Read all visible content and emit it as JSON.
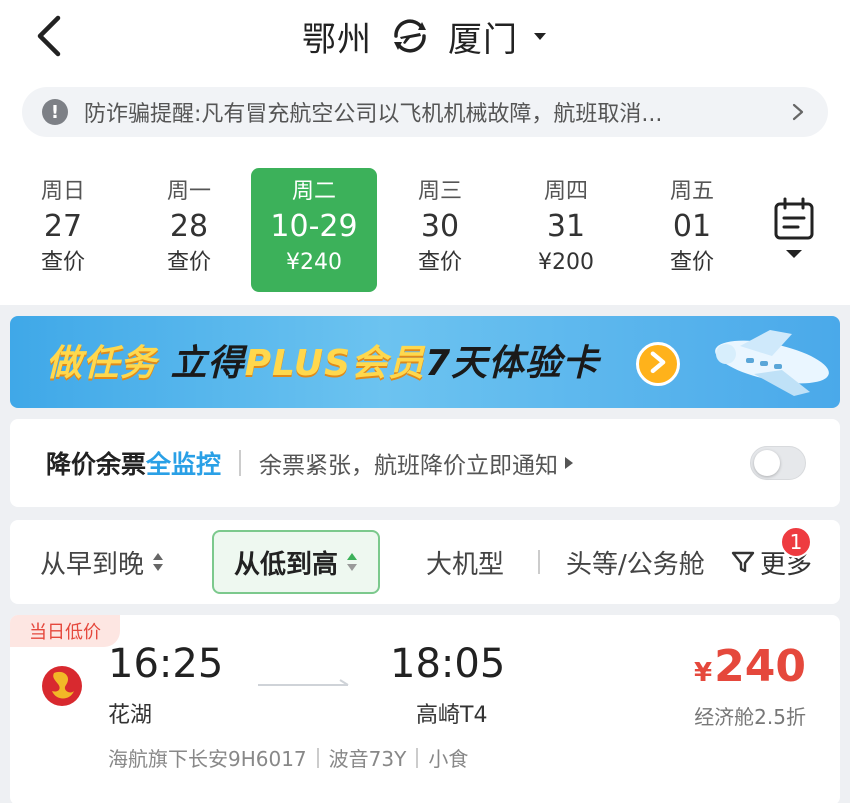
{
  "header": {
    "origin": "鄂州",
    "destination": "厦门"
  },
  "notice": {
    "text": "防诈骗提醒:凡有冒充航空公司以飞机机械故障，航班取消..."
  },
  "dates": [
    {
      "weekday": "周日",
      "day": "27",
      "price": "查价",
      "selected": false
    },
    {
      "weekday": "周一",
      "day": "28",
      "price": "查价",
      "selected": false
    },
    {
      "weekday": "周二",
      "day": "10-29",
      "price": "¥240",
      "selected": true
    },
    {
      "weekday": "周三",
      "day": "30",
      "price": "查价",
      "selected": false
    },
    {
      "weekday": "周四",
      "day": "31",
      "price": "¥200",
      "selected": false
    },
    {
      "weekday": "周五",
      "day": "01",
      "price": "查价",
      "selected": false
    }
  ],
  "banner": {
    "part1": "做任务",
    "part2": "立得",
    "part3": "PLUS会员",
    "part4": "7天体验卡"
  },
  "monitor": {
    "label_a": "降价余票",
    "label_b": "全监控",
    "desc": "余票紧张，航班降价立即通知",
    "enabled": false
  },
  "sort": {
    "options": [
      "从早到晚",
      "从低到高",
      "大机型",
      "头等/公务舱"
    ],
    "active": "从低到高",
    "more_label": "更多",
    "badge": "1"
  },
  "flight": {
    "tag": "当日低价",
    "dep_time": "16:25",
    "dep_airport": "花湖",
    "arr_time": "18:05",
    "arr_airport": "高崎T4",
    "currency": "¥",
    "price": "240",
    "cabin": "经济舱2.5折",
    "carrier": "海航旗下长安9H6017",
    "aircraft": "波音73Y",
    "meal": "小食"
  },
  "colors": {
    "accent_green": "#3cb15a",
    "price_red": "#e5483c",
    "monitor_blue": "#2aa0e6",
    "banner_blue": "#3fa8e8"
  }
}
